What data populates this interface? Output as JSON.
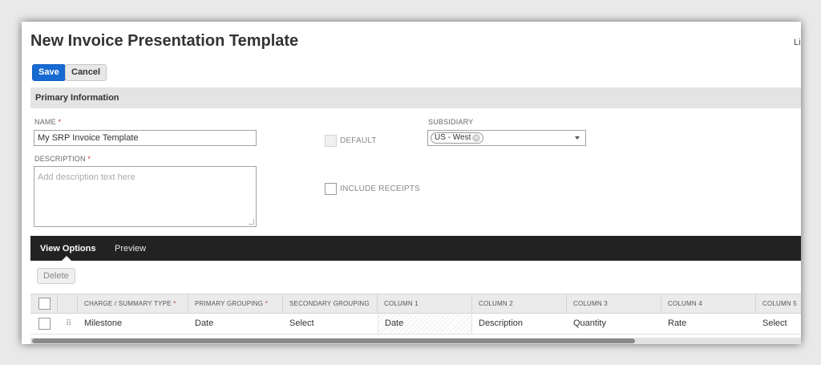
{
  "page": {
    "title": "New Invoice Presentation Template",
    "top_right_text": "Li"
  },
  "toolbar": {
    "save_label": "Save",
    "cancel_label": "Cancel"
  },
  "primary_information": {
    "section_title": "Primary Information",
    "name": {
      "label": "NAME",
      "required_mark": "*",
      "value": "My SRP Invoice Template"
    },
    "description": {
      "label": "DESCRIPTION",
      "required_mark": "*",
      "value": "",
      "placeholder": "Add description text here"
    },
    "default_checkbox": {
      "label": "DEFAULT",
      "checked": false,
      "disabled": true
    },
    "include_receipts_checkbox": {
      "label": "INCLUDE RECEIPTS",
      "checked": false
    },
    "subsidiary": {
      "label": "SUBSIDIARY",
      "selected": "US - West",
      "remove_icon": "x-circle-icon",
      "dropdown_icon": "caret-down-icon"
    }
  },
  "tabs": [
    {
      "label": "View Options",
      "active": true
    },
    {
      "label": "Preview",
      "active": false
    }
  ],
  "view_options": {
    "delete_label": "Delete",
    "columns": [
      {
        "label": ""
      },
      {
        "label": ""
      },
      {
        "label": "CHARGE / SUMMARY TYPE",
        "required_mark": "*"
      },
      {
        "label": "PRIMARY GROUPING",
        "required_mark": "*"
      },
      {
        "label": "SECONDARY GROUPING"
      },
      {
        "label": "COLUMN 1"
      },
      {
        "label": "COLUMN 2"
      },
      {
        "label": "COLUMN 3"
      },
      {
        "label": "COLUMN 4"
      },
      {
        "label": "COLUMN 5"
      }
    ],
    "rows": [
      {
        "checked": false,
        "drag_icon": "drag-handle-icon",
        "cells": [
          "Milestone",
          "Date",
          "Select",
          "Date",
          "Description",
          "Quantity",
          "Rate",
          "Select"
        ]
      }
    ]
  },
  "colors": {
    "primary_button": "#176ad1",
    "tab_bar": "#222222",
    "required": "#c43232"
  }
}
